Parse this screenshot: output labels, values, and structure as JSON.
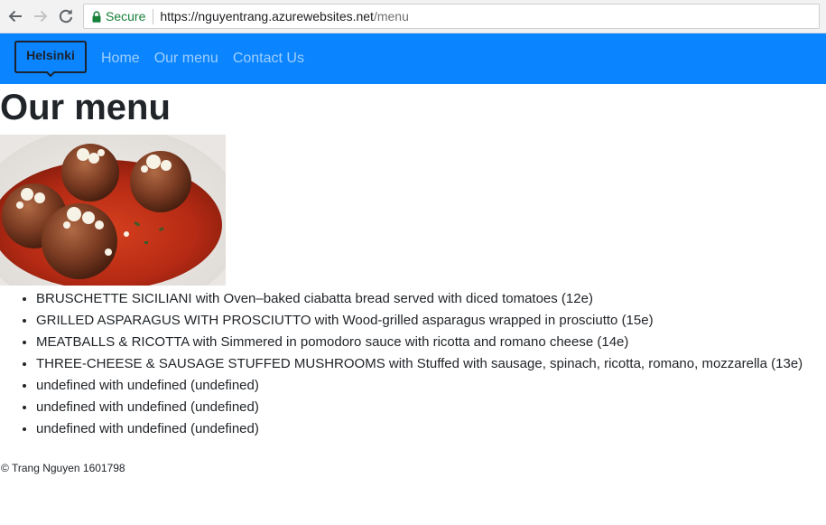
{
  "browser": {
    "secure_label": "Secure",
    "url_host": "https://nguyentrang.azurewebsites.net",
    "url_path": "/menu"
  },
  "navbar": {
    "brand": "Helsinki",
    "links": [
      "Home",
      "Our menu",
      "Contact Us"
    ],
    "background_color": "#0a84ff"
  },
  "page": {
    "title": "Our menu",
    "items": [
      "BRUSCHETTE SICILIANI with Oven–baked ciabatta bread served with diced tomatoes (12e)",
      "GRILLED ASPARAGUS WITH PROSCIUTTO with Wood-grilled asparagus wrapped in prosciutto (15e)",
      "MEATBALLS & RICOTTA with Simmered in pomodoro sauce with ricotta and romano cheese (14e)",
      "THREE-CHEESE & SAUSAGE STUFFED MUSHROOMS with Stuffed with sausage, spinach, ricotta, romano, mozzarella (13e)",
      "undefined with undefined (undefined)",
      "undefined with undefined (undefined)",
      "undefined with undefined (undefined)"
    ]
  },
  "footer": {
    "text": "© Trang Nguyen 1601798"
  }
}
